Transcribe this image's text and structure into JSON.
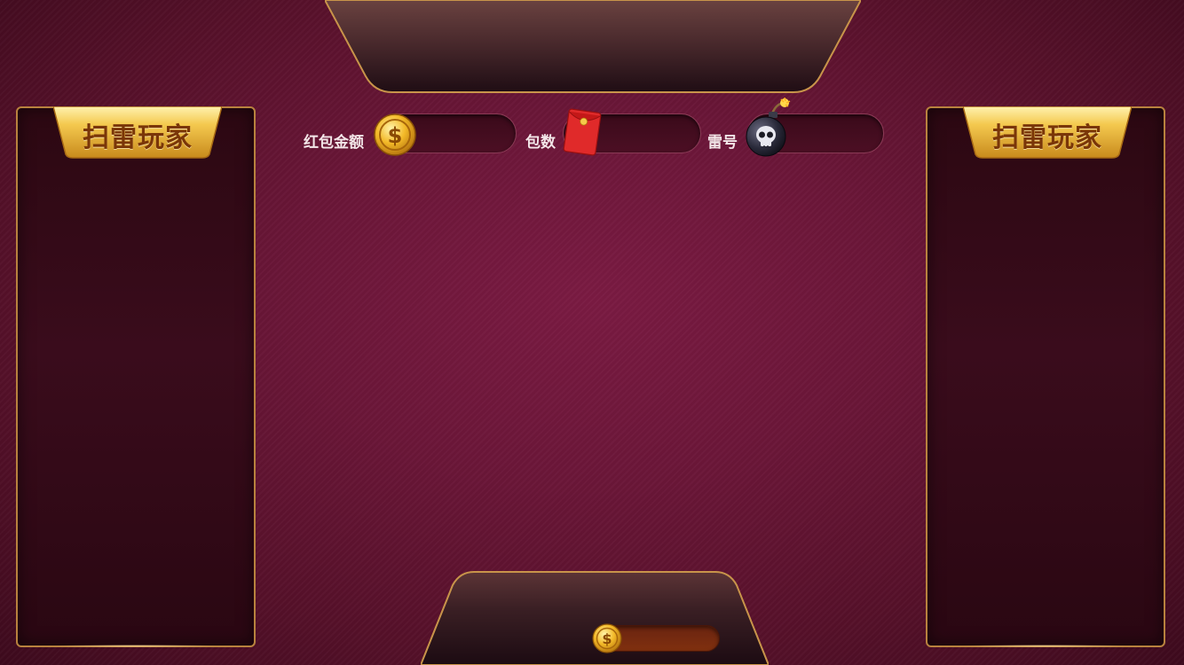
{
  "left_panel": {
    "title": "扫雷玩家"
  },
  "right_panel": {
    "title": "扫雷玩家"
  },
  "info_bar": {
    "amount_label": "红包金额",
    "amount_value": "",
    "amount_icon": "gold-coin-icon",
    "count_label": "包数",
    "count_value": "",
    "count_icon": "red-envelope-icon",
    "mine_label": "雷号",
    "mine_value": "",
    "mine_icon": "skull-bomb-icon"
  },
  "bottom_bar": {
    "coin_icon": "gold-coin-icon",
    "balance_value": ""
  },
  "colors": {
    "background": "#6b1638",
    "panel_border": "#b8823e",
    "title_text": "#7a3608",
    "badge_gold": "#f2c34a",
    "coin_pill": "#80300f"
  }
}
